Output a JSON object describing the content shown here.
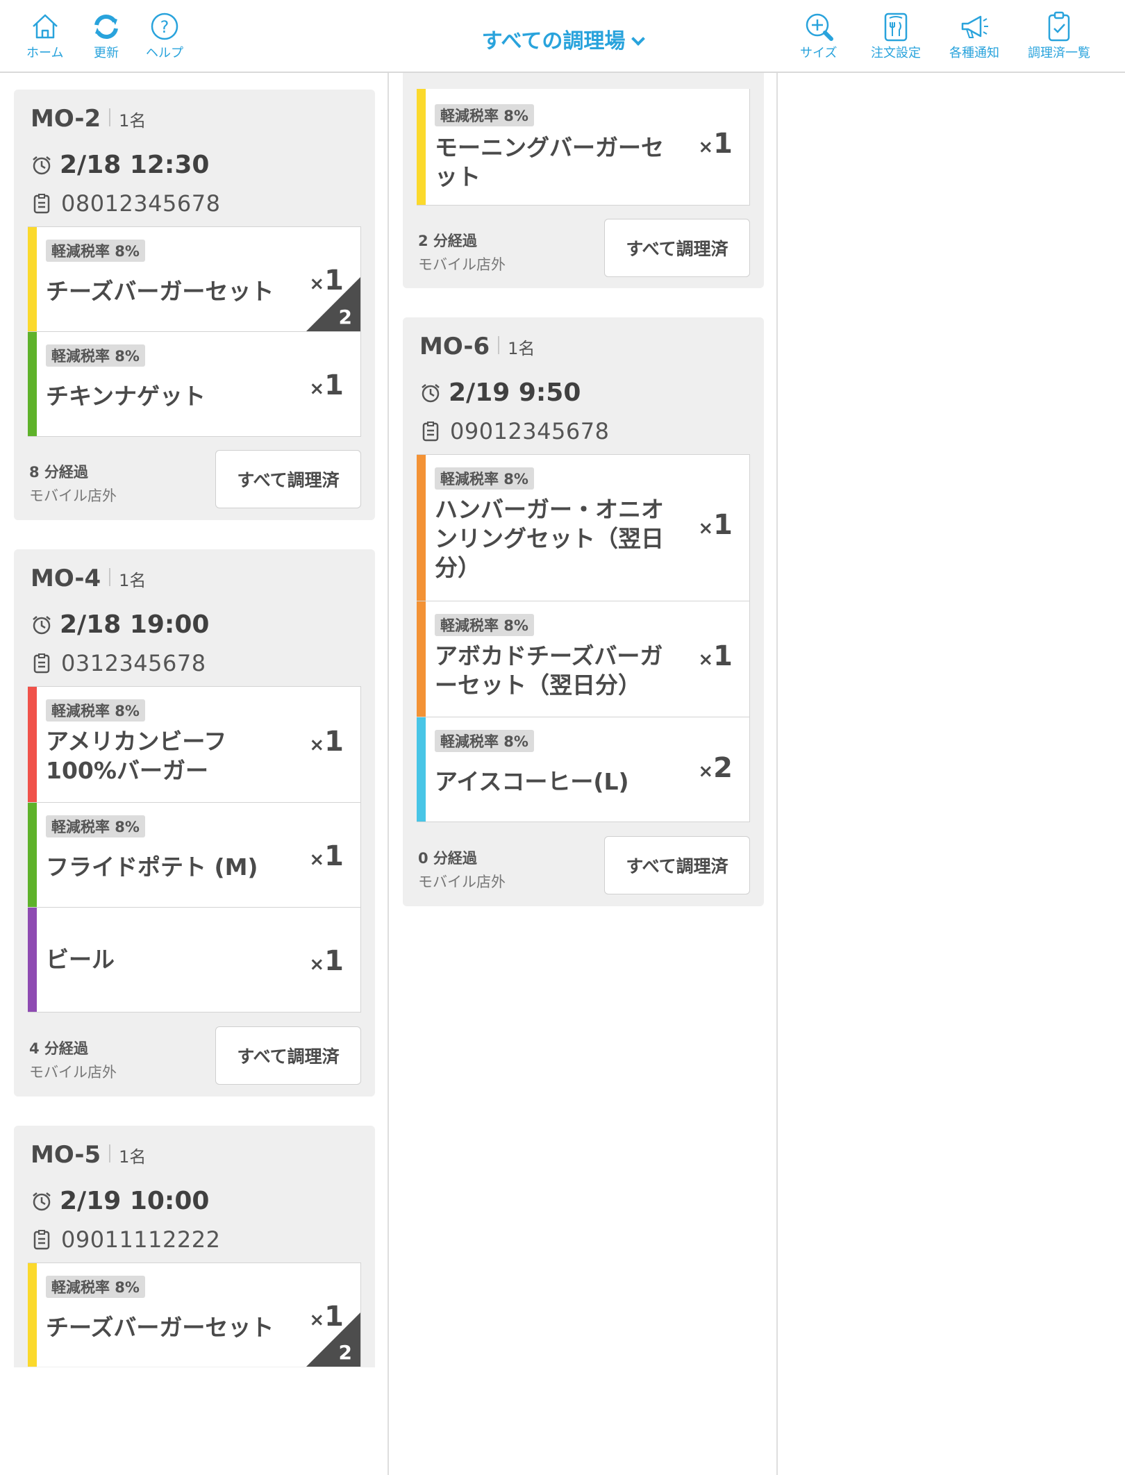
{
  "header": {
    "title": "すべての調理場",
    "left_buttons": [
      {
        "label": "ホーム",
        "icon": "home-icon"
      },
      {
        "label": "更新",
        "icon": "refresh-icon"
      },
      {
        "label": "ヘルプ",
        "icon": "help-icon"
      }
    ],
    "right_buttons": [
      {
        "label": "サイズ",
        "icon": "zoom-icon"
      },
      {
        "label": "注文設定",
        "icon": "menu-settings-icon"
      },
      {
        "label": "各種通知",
        "icon": "megaphone-icon"
      },
      {
        "label": "調理済一覧",
        "icon": "clipboard-check-icon"
      }
    ]
  },
  "colors": {
    "accent": "#29a3dc",
    "yellow": "#fbd92c",
    "green": "#5eb22a",
    "red": "#f0524a",
    "purple": "#8e4bb2",
    "orange": "#f39235",
    "cyan": "#48c5e6"
  },
  "cards": {
    "mo2": {
      "order_no": "MO-2",
      "guests": "1名",
      "time": "2/18 12:30",
      "phone": "08012345678",
      "items": [
        {
          "tax": "軽減税率 8%",
          "name": "チーズバーガーセット",
          "qty_x": "×",
          "qty": "1",
          "badge": "2"
        },
        {
          "tax": "軽減税率 8%",
          "name": "チキンナゲット",
          "qty_x": "×",
          "qty": "1"
        }
      ],
      "elapsed": "8 分経過",
      "place": "モバイル店外",
      "done_label": "すべて調理済"
    },
    "mo4": {
      "order_no": "MO-4",
      "guests": "1名",
      "time": "2/18 19:00",
      "phone": "0312345678",
      "items": [
        {
          "tax": "軽減税率 8%",
          "name": "アメリカンビーフ100%バーガー",
          "qty_x": "×",
          "qty": "1"
        },
        {
          "tax": "軽減税率 8%",
          "name": "フライドポテト (M)",
          "qty_x": "×",
          "qty": "1"
        },
        {
          "name": "ビール",
          "qty_x": "×",
          "qty": "1"
        }
      ],
      "elapsed": "4 分経過",
      "place": "モバイル店外",
      "done_label": "すべて調理済"
    },
    "mo5": {
      "order_no": "MO-5",
      "guests": "1名",
      "time": "2/19 10:00",
      "phone": "09011112222",
      "items": [
        {
          "tax": "軽減税率 8%",
          "name": "チーズバーガーセット",
          "qty_x": "×",
          "qty": "1",
          "badge": "2"
        }
      ]
    },
    "cont": {
      "items": [
        {
          "tax": "軽減税率 8%",
          "name": "モーニングバーガーセット",
          "qty_x": "×",
          "qty": "1"
        }
      ],
      "elapsed": "2 分経過",
      "place": "モバイル店外",
      "done_label": "すべて調理済"
    },
    "mo6": {
      "order_no": "MO-6",
      "guests": "1名",
      "time": "2/19 9:50",
      "phone": "09012345678",
      "items": [
        {
          "tax": "軽減税率 8%",
          "name": "ハンバーガー・オニオンリングセット（翌日分）",
          "qty_x": "×",
          "qty": "1"
        },
        {
          "tax": "軽減税率 8%",
          "name": "アボカドチーズバーガーセット（翌日分）",
          "qty_x": "×",
          "qty": "1"
        },
        {
          "tax": "軽減税率 8%",
          "name": "アイスコーヒー(L)",
          "qty_x": "×",
          "qty": "2"
        }
      ],
      "elapsed": "0 分経過",
      "place": "モバイル店外",
      "done_label": "すべて調理済"
    }
  }
}
